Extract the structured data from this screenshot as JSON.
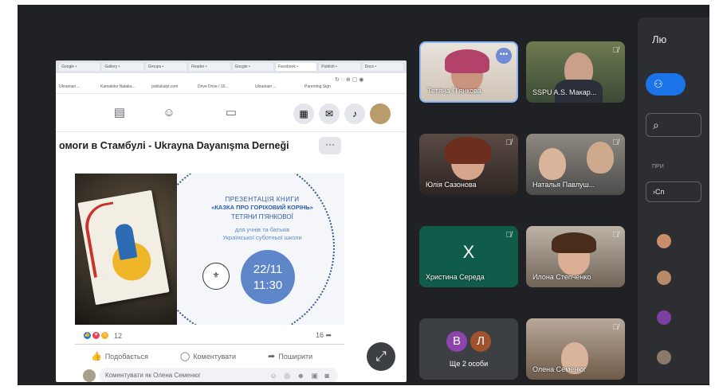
{
  "browser": {
    "tabs": [
      "Google •",
      "Gallery •",
      "Groups •",
      "Reader •",
      "Google •",
      "Facebook •",
      "Publish •",
      "Docs •"
    ],
    "bookmarks": [
      "Ukrainian ...",
      "Kamaleko Natalia...",
      "poblukalyt.com",
      "Drive Drive / 16...",
      "Ukrainian ...",
      "Parenting Sign"
    ]
  },
  "post": {
    "title": "омоги в Стамбулі - Ukrayna Dayanışma Derneği",
    "more_label": "···",
    "graphic": {
      "heading1": "ПРЕЗЕНТАЦІЯ КНИГИ",
      "heading2": "«КАЗКА ПРО ГОРІХОВИЙ КОРІНЬ»",
      "heading3": "ТЕТЯНИ П'ЯНКОВОЇ",
      "sub1": "для учнів та батьків",
      "sub2": "Української суботньої школи",
      "date": "22/11",
      "time": "11:30"
    },
    "reaction_count": "12",
    "shares_count": "16",
    "like_label": "Подобається",
    "comment_label": "Коментувати",
    "share_label": "Поширити",
    "comment_placeholder": "Коментувати як Олена Семенюг"
  },
  "tiles": [
    {
      "name": "Тетяна П'янкова",
      "muted": false,
      "has_more": true
    },
    {
      "name": "SSPU A.S. Макар...",
      "muted": true
    },
    {
      "name": "Юлія Сазонова",
      "muted": true
    },
    {
      "name": "Наталья Павлуш...",
      "muted": true
    },
    {
      "name": "Христина Середа",
      "muted": true,
      "letter": "Х"
    },
    {
      "name": "Илона Степченко",
      "muted": true
    },
    {
      "label": "Ще 2 особи",
      "initials": [
        "В",
        "Л"
      ]
    },
    {
      "name": "Олена Семенюг",
      "muted": true
    }
  ],
  "panel": {
    "title": "Лю",
    "section_label": "ПРИ",
    "chip": "Сп"
  },
  "colors": {
    "meet_bg": "#202124",
    "accent_blue": "#1a73e8",
    "tile_bg": "#3c4043",
    "graphic_blue": "#5e86c9"
  }
}
